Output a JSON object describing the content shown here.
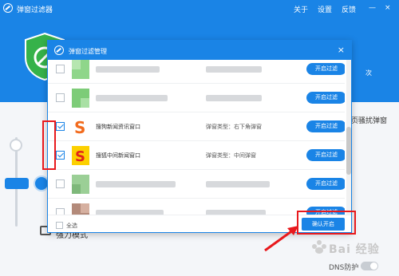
{
  "app": {
    "title": "弹窗过滤器",
    "menu": [
      "关于",
      "设置",
      "反馈"
    ],
    "header_extra": "次",
    "right_label": "页骚扰弹窗",
    "bottom_text": "强力模式",
    "dns_label": "DNS防护"
  },
  "dialog": {
    "title": "弹窗过滤管理",
    "close": "×",
    "rows": [
      {
        "name": "",
        "type": "",
        "button": "开启过滤",
        "checked": false,
        "blurred": true
      },
      {
        "name": "",
        "type": "",
        "button": "开启过滤",
        "checked": false,
        "blurred": true
      },
      {
        "name": "搜狗新闻资讯窗口",
        "type": "弹窗类型：右下角弹窗",
        "button": "开启过滤",
        "checked": true,
        "blurred": false
      },
      {
        "name": "搜狐中间新闻窗口",
        "type": "弹窗类型：中间弹窗",
        "button": "开启过滤",
        "checked": true,
        "blurred": false
      },
      {
        "name": "",
        "type": "",
        "button": "开启过滤",
        "checked": false,
        "blurred": true
      },
      {
        "name": "",
        "type": "",
        "button": "开启过滤",
        "checked": false,
        "blurred": true
      }
    ],
    "select_all": "全选",
    "confirm": "确认开启"
  },
  "watermark": "Bai 经验",
  "colors": {
    "accent": "#1a84e6",
    "annotation": "#e8191d"
  }
}
